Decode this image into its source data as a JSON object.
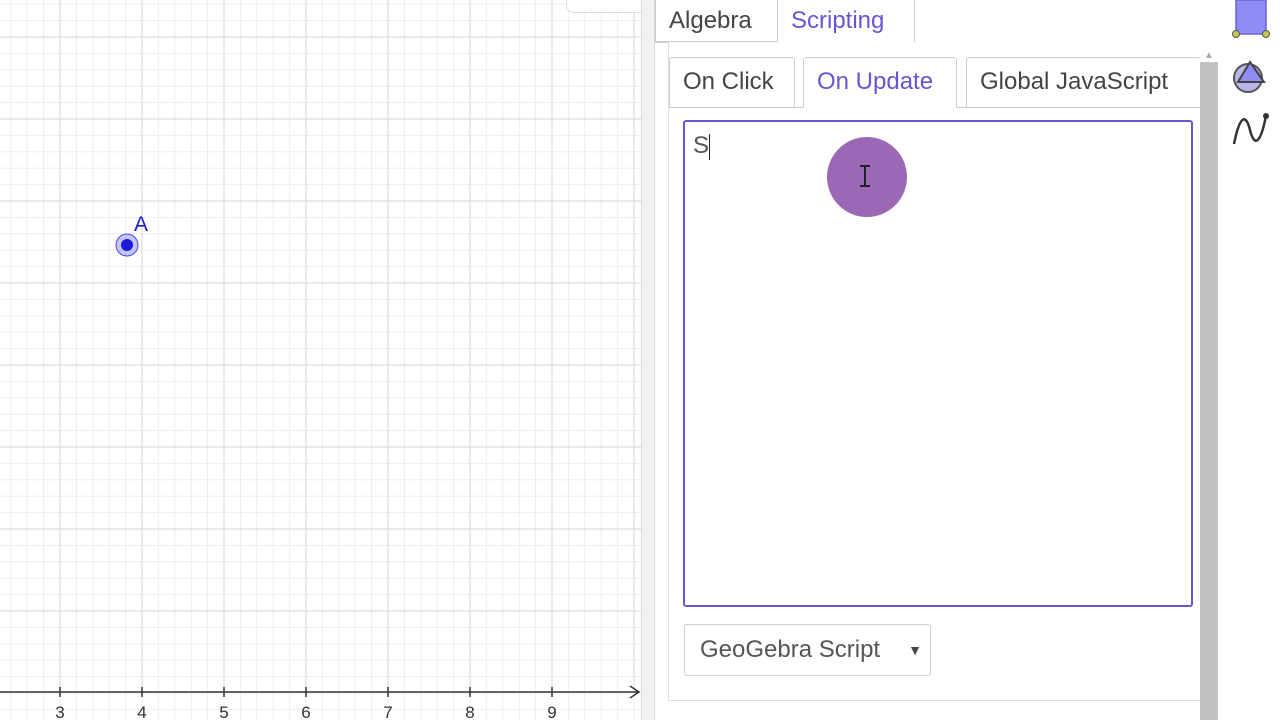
{
  "graphics": {
    "x_axis_labels": [
      "3",
      "4",
      "5",
      "6",
      "7",
      "8",
      "9"
    ],
    "point": {
      "label": "A",
      "color": "#1a1ad6"
    }
  },
  "panel": {
    "tabs": [
      {
        "label": "Algebra",
        "active": false
      },
      {
        "label": "Scripting",
        "active": true
      }
    ],
    "script_tabs": [
      {
        "label": "On Click",
        "active": false
      },
      {
        "label": "On Update",
        "active": true
      },
      {
        "label": "Global JavaScript",
        "active": false
      }
    ],
    "script_text": "S",
    "language_select": {
      "selected": "GeoGebra Script",
      "arrow": "▼"
    },
    "accent_color": "#6557d2"
  },
  "toolbar": {
    "tools": [
      "move-tool",
      "polygon-tool",
      "function-tool"
    ]
  }
}
